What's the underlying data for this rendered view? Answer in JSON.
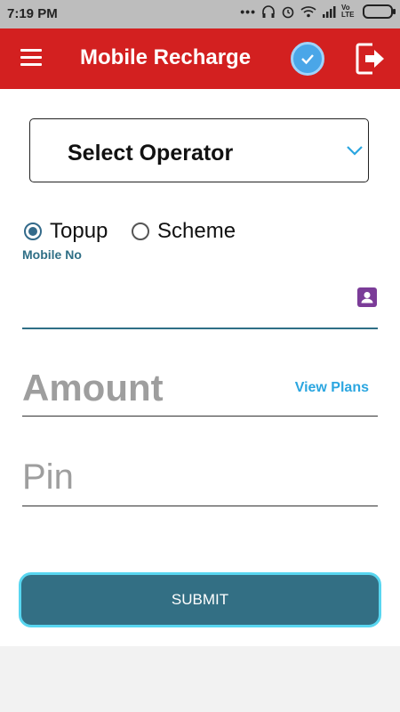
{
  "status_bar": {
    "time": "7:19 PM",
    "dots": "•••",
    "network": "Vo LTE"
  },
  "app_bar": {
    "title": "Mobile Recharge"
  },
  "operator_select": {
    "selected": "Select Operator"
  },
  "recharge_type": {
    "options": [
      "Topup",
      "Scheme"
    ],
    "selected": "Topup"
  },
  "mobile": {
    "label": "Mobile No",
    "value": ""
  },
  "amount": {
    "placeholder": "Amount",
    "view_plans_label": "View Plans"
  },
  "pin": {
    "placeholder": "Pin"
  },
  "submit_label": "SUBMIT",
  "colors": {
    "app_bar": "#d32020",
    "accent": "#336f84",
    "link": "#2ba6e0"
  }
}
